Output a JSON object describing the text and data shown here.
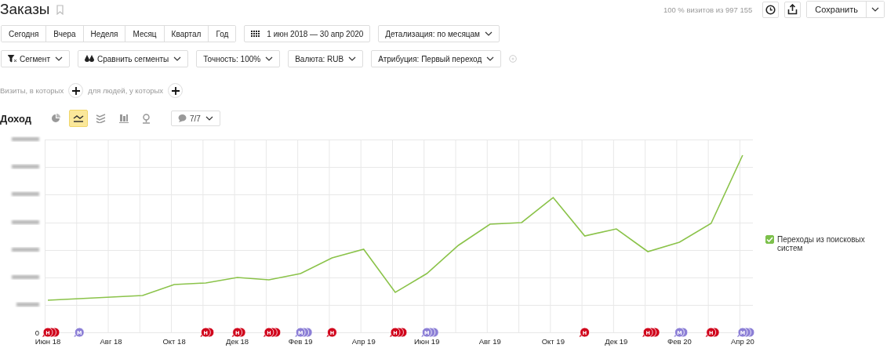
{
  "title": "Заказы",
  "header": {
    "sample": "100 % визитов из 997 155",
    "save_button": "Сохранить"
  },
  "periods": [
    "Сегодня",
    "Вчера",
    "Неделя",
    "Месяц",
    "Квартал",
    "Год"
  ],
  "date_range": "1 июн 2018 — 30 апр 2020",
  "detail_dropdown": "Детализация: по месяцам",
  "filters": [
    {
      "kind": "segment",
      "label": "Сегмент"
    },
    {
      "kind": "compare",
      "label": "Сравнить сегменты"
    },
    {
      "kind": "plain",
      "label": "Точность: 100%"
    },
    {
      "kind": "plain",
      "label": "Валюта: RUB"
    },
    {
      "kind": "plain",
      "label": "Атрибуция: Первый переход"
    }
  ],
  "conditions": [
    "Визиты, в которых",
    "для людей, у которых"
  ],
  "metric": "Доход",
  "chart_types": [
    {
      "kind": "pie",
      "selected": false
    },
    {
      "kind": "line",
      "selected": true
    },
    {
      "kind": "stacked",
      "selected": false
    },
    {
      "kind": "bars",
      "selected": false
    },
    {
      "kind": "map",
      "selected": false
    }
  ],
  "notes_dropdown": "7/7",
  "chart": {
    "zero_label": "0",
    "x_labels": [
      "Июн 18",
      "Авг 18",
      "Окт 18",
      "Дек 18",
      "Фев 19",
      "Апр 19",
      "Июн 19",
      "Авг 19",
      "Окт 19",
      "Дек 19",
      "Фев 20",
      "Апр 20"
    ],
    "markers": [
      {
        "label": "Н",
        "kind": "triple",
        "color": "#d0021b"
      },
      {
        "label": "М",
        "kind": "single",
        "color": "#8c7fd6"
      },
      {
        "label": "Н",
        "kind": "double",
        "color": "#d0021b"
      },
      {
        "label": "Н",
        "kind": "double",
        "color": "#d0021b"
      },
      {
        "label": "Н",
        "kind": "triple",
        "color": "#d0021b"
      },
      {
        "label": "М",
        "kind": "triple",
        "color": "#8c7fd6"
      },
      {
        "label": "Н",
        "kind": "single",
        "color": "#d0021b"
      },
      {
        "label": "Н",
        "kind": "triple",
        "color": "#d0021b"
      },
      {
        "label": "М",
        "kind": "triple",
        "color": "#8c7fd6"
      },
      {
        "label": "Н",
        "kind": "single",
        "color": "#d0021b"
      },
      {
        "label": "Н",
        "kind": "triple",
        "color": "#d0021b"
      },
      {
        "label": "М",
        "kind": "double",
        "color": "#8c7fd6"
      },
      {
        "label": "Н",
        "kind": "double",
        "color": "#d0021b"
      },
      {
        "label": "М",
        "kind": "triple",
        "color": "#8c7fd6"
      }
    ]
  },
  "legend": [
    {
      "label": "Переходы из поисковых систем",
      "checked": true
    }
  ]
}
